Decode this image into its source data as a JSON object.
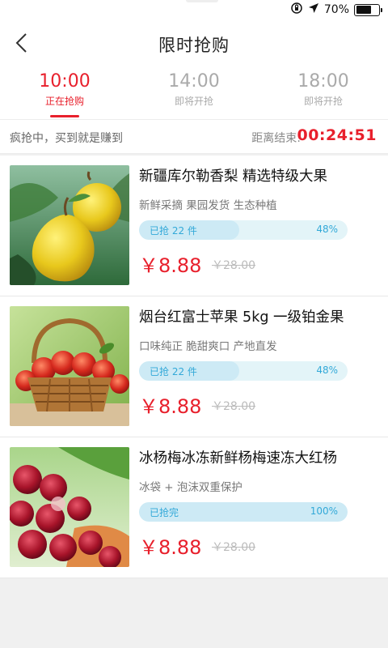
{
  "status": {
    "battery": "70%",
    "battery_level": 0.7
  },
  "nav": {
    "title": "限时抢购"
  },
  "tabs": [
    {
      "time": "10:00",
      "status": "正在抢购"
    },
    {
      "time": "14:00",
      "status": "即将开抢"
    },
    {
      "time": "18:00",
      "status": "即将开抢"
    }
  ],
  "info": {
    "slogan": "疯抢中，买到就是赚到",
    "countdown_label": "距离结束:",
    "countdown": "00:24:51"
  },
  "products": [
    {
      "title": "新疆库尔勒香梨 精选特级大果",
      "tags": "新鲜采摘 果园发货 生态种植",
      "sold": "已抢 22 件",
      "percent": "48%",
      "progress": 0.48,
      "price": "￥8.88",
      "original_price": "￥28.00",
      "image": "pear"
    },
    {
      "title": "烟台红富士苹果 5kg 一级铂金果",
      "tags": "口味纯正 脆甜爽口 产地直发",
      "sold": "已抢 22 件",
      "percent": "48%",
      "progress": 0.48,
      "price": "￥8.88",
      "original_price": "￥28.00",
      "image": "apple-basket"
    },
    {
      "title": "冰杨梅冰冻新鲜杨梅速冻大红杨",
      "tags": "冰袋 + 泡沫双重保护",
      "sold": "已抢完",
      "percent": "100%",
      "progress": 1.0,
      "price": "￥8.88",
      "original_price": "￥28.00",
      "image": "bayberry"
    }
  ]
}
